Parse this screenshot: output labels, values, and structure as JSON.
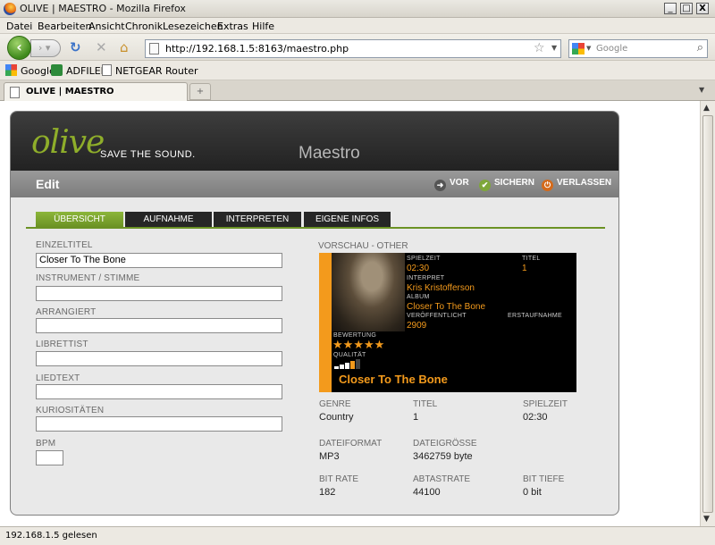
{
  "window": {
    "title": "OLIVE | MAESTRO - Mozilla Firefox",
    "controls": {
      "minimize": "_",
      "maximize": "□",
      "close": "X"
    }
  },
  "menu": [
    "Datei",
    "Bearbeiten",
    "Ansicht",
    "Chronik",
    "Lesezeichen",
    "Extras",
    "Hilfe"
  ],
  "nav": {
    "url": "http://192.168.1.5:8163/maestro.php",
    "search_placeholder": "Google"
  },
  "bookmarks": [
    "Google",
    "ADFILER",
    "NETGEAR Router"
  ],
  "browser_tab": {
    "label": "OLIVE | MAESTRO"
  },
  "status": {
    "text": "192.168.1.5 gelesen"
  },
  "app": {
    "logo": "olive",
    "slogan": "SAVE THE SOUND.",
    "title": "Maestro",
    "section": "Edit",
    "actions": {
      "prev": "VOR",
      "save": "SICHERN",
      "exit": "VERLASSEN"
    },
    "tabs": [
      "ÜBERSICHT",
      "AUFNAHME",
      "INTERPRETEN",
      "EIGENE INFOS"
    ],
    "active_tab": 0,
    "form": {
      "einzeltitel": {
        "label": "EINZELTITEL",
        "value": "Closer To The Bone"
      },
      "instrument": {
        "label": "INSTRUMENT / STIMME",
        "value": ""
      },
      "arrangiert": {
        "label": "ARRANGIERT",
        "value": ""
      },
      "librettist": {
        "label": "LIBRETTIST",
        "value": ""
      },
      "liedtext": {
        "label": "LIEDTEXT",
        "value": ""
      },
      "kuriositaeten": {
        "label": "KURIOSITÄTEN",
        "value": ""
      },
      "bpm": {
        "label": "BPM",
        "value": ""
      }
    },
    "preview": {
      "heading": "VORSCHAU - OTHER",
      "spielzeit_label": "SPIELZEIT",
      "spielzeit": "02:30",
      "titel_label": "TITEL",
      "titel": "1",
      "interpret_label": "INTERPRET",
      "interpret": "Kris Kristofferson",
      "album_label": "ALBUM",
      "album": "Closer To The Bone",
      "veroeffentlicht_label": "VERÖFFENTLICHT",
      "veroeffentlicht": "2909",
      "erstaufnahme_label": "ERSTAUFNAHME",
      "bewertung_label": "BEWERTUNG",
      "rating": 5,
      "rating_max": 5,
      "qualitaet_label": "QUALITÄT",
      "quality": 4,
      "quality_max": 5,
      "big_title": "Closer To The Bone",
      "accent_color": "#f39a1c"
    },
    "info": {
      "genre": {
        "label": "GENRE",
        "value": "Country"
      },
      "titel": {
        "label": "TITEL",
        "value": "1"
      },
      "spielzeit": {
        "label": "SPIELZEIT",
        "value": "02:30"
      },
      "dateiformat": {
        "label": "DATEIFORMAT",
        "value": "MP3"
      },
      "dateigroesse": {
        "label": "DATEIGRÖSSE",
        "value": "3462759 byte"
      },
      "bitrate": {
        "label": "BIT RATE",
        "value": "182"
      },
      "abtastrate": {
        "label": "ABTASTRATE",
        "value": "44100"
      },
      "bittiefe": {
        "label": "BIT TIEFE",
        "value": "0 bit"
      }
    }
  }
}
